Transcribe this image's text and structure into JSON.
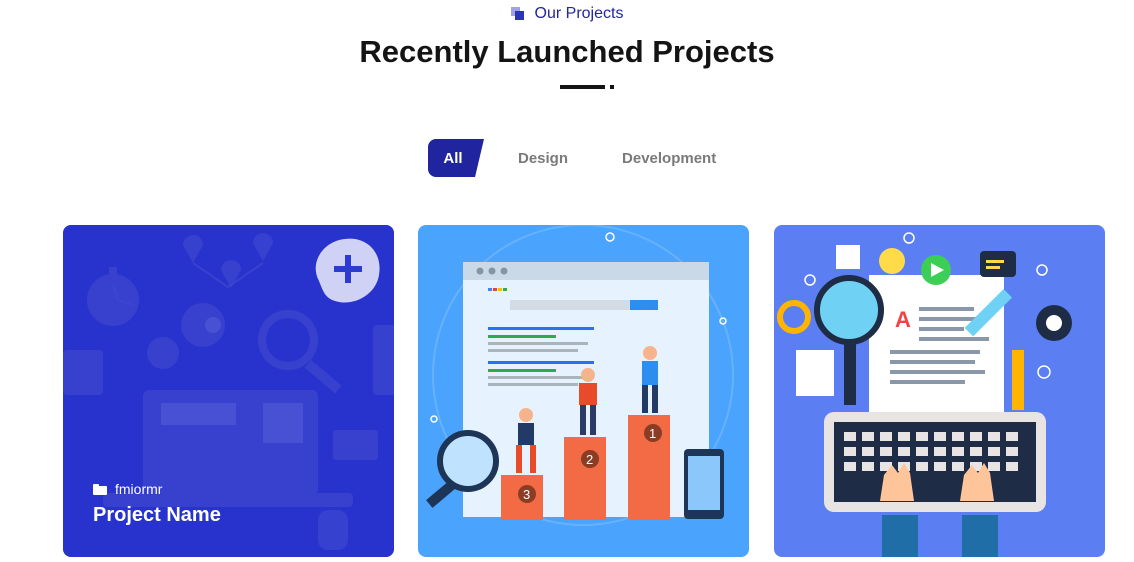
{
  "section": {
    "eyebrow": "Our Projects",
    "title": "Recently Launched Projects"
  },
  "filters": [
    {
      "label": "All",
      "active": true
    },
    {
      "label": "Design",
      "active": false
    },
    {
      "label": "Development",
      "active": false
    }
  ],
  "projects": [
    {
      "category": "fmiormr",
      "name": "Project Name",
      "illustration": "laptop-analytics-illustration",
      "hovered": true
    },
    {
      "illustration": "seo-ranking-podium-illustration"
    },
    {
      "illustration": "content-writing-keyboard-illustration"
    }
  ],
  "colors": {
    "accent": "#20259f",
    "heading": "#141414",
    "filter_inactive": "#7a7a7a",
    "card1": "#2b3bd3",
    "card2": "#4aa3fc",
    "card3": "#5b7ff3"
  }
}
